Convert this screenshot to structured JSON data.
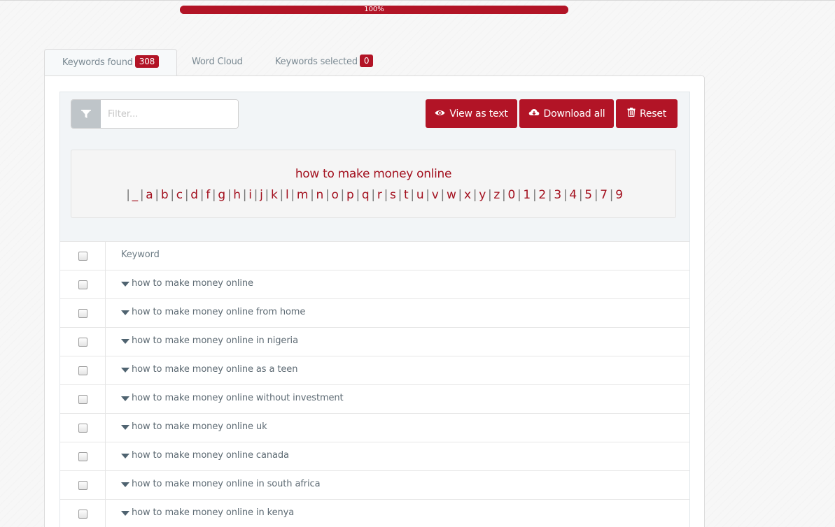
{
  "progress": {
    "percent": 100,
    "label": "100%"
  },
  "tabs": [
    {
      "label": "Keywords found",
      "badge": "308",
      "active": true
    },
    {
      "label": "Word Cloud"
    },
    {
      "label": "Keywords selected",
      "badge": "0"
    }
  ],
  "filter": {
    "placeholder": "Filter...",
    "value": ""
  },
  "toolbar": {
    "view_as_text": "View as text",
    "download_all": "Download all",
    "reset": "Reset"
  },
  "letters": {
    "query": "how to make money online",
    "items": [
      "_",
      "a",
      "b",
      "c",
      "d",
      "f",
      "g",
      "h",
      "i",
      "j",
      "k",
      "l",
      "m",
      "n",
      "o",
      "p",
      "q",
      "r",
      "s",
      "t",
      "u",
      "v",
      "w",
      "x",
      "y",
      "z",
      "0",
      "1",
      "2",
      "3",
      "4",
      "5",
      "7",
      "9"
    ]
  },
  "table": {
    "header": "Keyword",
    "rows": [
      "how to make money online",
      "how to make money online from home",
      "how to make money online in nigeria",
      "how to make money online as a teen",
      "how to make money online without investment",
      "how to make money online uk",
      "how to make money online canada",
      "how to make money online in south africa",
      "how to make money online in kenya"
    ]
  },
  "colors": {
    "accent": "#b21426"
  }
}
